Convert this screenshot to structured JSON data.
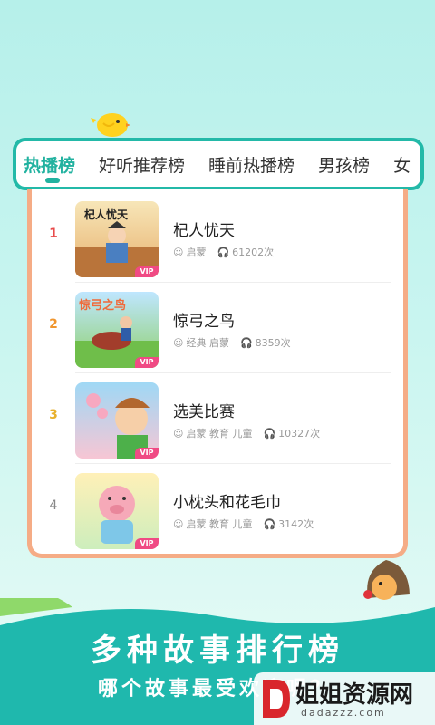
{
  "tabs": [
    {
      "label": "热播榜"
    },
    {
      "label": "好听推荐榜"
    },
    {
      "label": "睡前热播榜"
    },
    {
      "label": "男孩榜"
    },
    {
      "label": "女"
    }
  ],
  "list": [
    {
      "rank": "1",
      "rank_color": "#e84b4b",
      "title": "杞人忧天",
      "tags": "启蒙",
      "plays": "61202次",
      "cover_text": "杞人忧天",
      "vip": "VIP"
    },
    {
      "rank": "2",
      "rank_color": "#f0962f",
      "title": "惊弓之鸟",
      "tags": "经典 启蒙",
      "plays": "8359次",
      "cover_text": "惊弓之鸟",
      "vip": "VIP"
    },
    {
      "rank": "3",
      "rank_color": "#e8b12c",
      "title": "选美比赛",
      "tags": "启蒙 教育 儿童",
      "plays": "10327次",
      "vip": "VIP"
    },
    {
      "rank": "4",
      "rank_color": "#888888",
      "title": "小枕头和花毛巾",
      "tags": "启蒙 教育 儿童",
      "plays": "3142次",
      "vip": "VIP"
    }
  ],
  "banner": {
    "title": "多种故事排行榜",
    "subtitle": "哪个故事最受欢迎呢？"
  },
  "watermark": {
    "text": "姐姐资源网",
    "url": "dadazzz.com"
  },
  "colors": {
    "accent": "#23b9a8",
    "card_border": "#f5ac86",
    "vip": "#f04a84"
  }
}
